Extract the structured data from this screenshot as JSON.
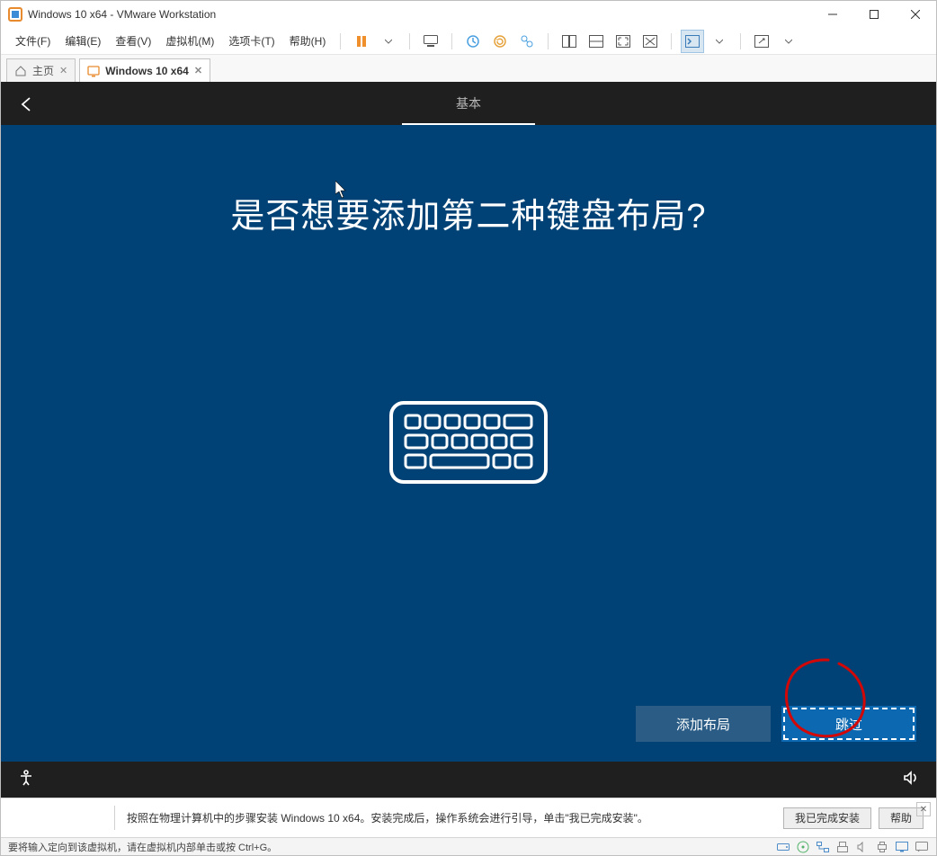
{
  "titlebar": {
    "title": "Windows 10 x64 - VMware Workstation"
  },
  "menubar": {
    "file": "文件(F)",
    "edit": "编辑(E)",
    "view": "查看(V)",
    "vm": "虚拟机(M)",
    "tabs": "选项卡(T)",
    "help": "帮助(H)"
  },
  "tabs": {
    "home": "主页",
    "vm": "Windows 10 x64"
  },
  "oobe": {
    "top_tab": "基本",
    "heading": "是否想要添加第二种键盘布局?",
    "add_layout": "添加布局",
    "skip": "跳过"
  },
  "prompt": {
    "message": "按照在物理计算机中的步骤安装 Windows 10 x64。安装完成后，操作系统会进行引导，单击\"我已完成安装\"。",
    "done": "我已完成安装",
    "help": "帮助"
  },
  "status": {
    "text": "要将输入定向到该虚拟机，请在虚拟机内部单击或按 Ctrl+G。"
  }
}
